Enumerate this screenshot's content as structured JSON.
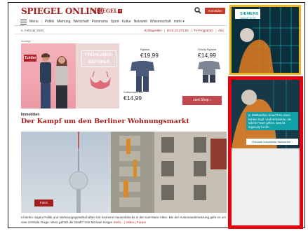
{
  "header": {
    "logo": "SPIEGEL ONLINE",
    "logo_plus": "SPIEGEL",
    "logo_plus_badge": "+",
    "search_icon": "search-icon",
    "login_label": "Anmelden"
  },
  "nav": {
    "menu_label": "Menü",
    "items": [
      "Politik",
      "Meinung",
      "Wirtschaft",
      "Panorama",
      "Sport",
      "Kultur",
      "Netzwelt",
      "Wissenschaft",
      "mehr ▾"
    ]
  },
  "subbar": {
    "date": "5. Februar 2020",
    "links": [
      "Schlagzeilen",
      "DAX 13.271,63",
      "TV-Programm",
      "Abo"
    ]
  },
  "ad": {
    "label": "Anzeige",
    "brand": "Tchibo",
    "headline_line1": "FRÜHLINGS-",
    "headline_line2": "GEFÜHLE",
    "product1_label": "Pyjama",
    "product1_price": "€19,99",
    "product2_label": "Shorty-Pyjama",
    "product2_price": "€14,99",
    "product3_label": "Softschalen-BH",
    "product3_price": "€14,99",
    "shop_button": "zum Shop ›"
  },
  "article": {
    "kicker": "Immobilien",
    "headline": "Der Kampf um den Berliner Wohnungsmarkt",
    "fotos_button": "Fotos",
    "teaser": "In Berlin ringen Politik und Wohnungsgesellschaften mit meinene Hausenblocks in der Karl-Marx-Allee. Bei der Auseinandersetzung geht es um eine zentrale Frage: Wem gehört die Stadt? Von Michael Kröger",
    "teaser_more": "mehr... | Video | Forum"
  },
  "sidebar": {
    "siemens_brand": "SIEMENS",
    "siemens_tagline": "Ingenuity for life",
    "ad2_text": "In Stahlwerken braucht es einen kühlen Kopf. Und Netzwerke, die solche Feuer gehen. Das ist Ingenuity for life.",
    "ad2_cta": "Robuste industrielle Netzwerke ›"
  },
  "colors": {
    "brand_red": "#a51e1e",
    "highlight_red": "#e8000f",
    "highlight_yellow": "#f0b41c"
  }
}
